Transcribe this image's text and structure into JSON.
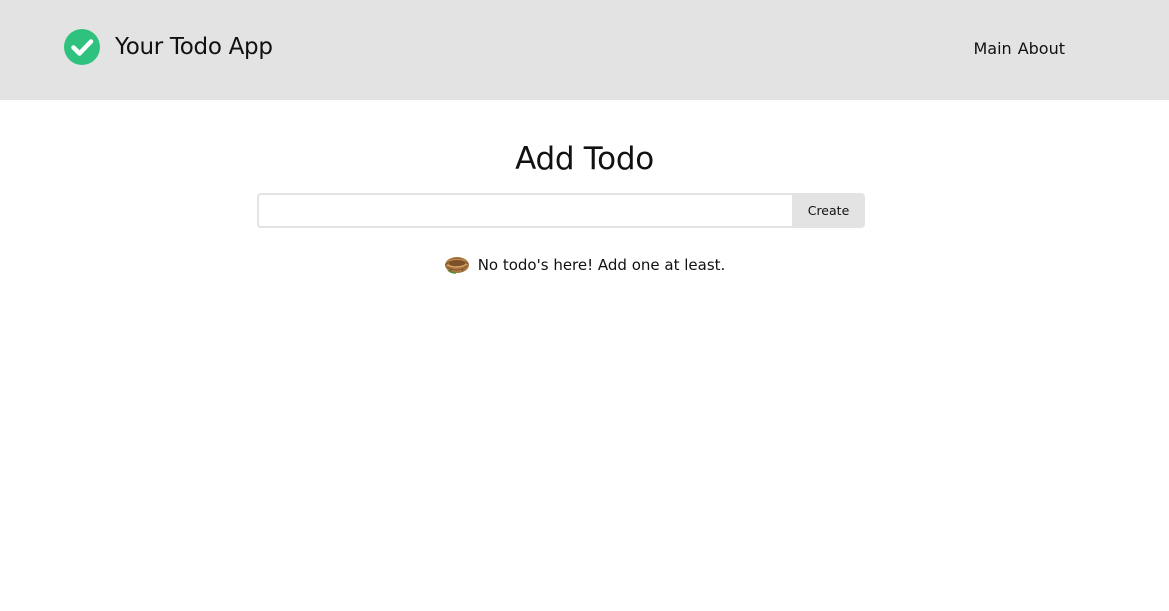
{
  "header": {
    "app_title": "Your Todo App",
    "logo_icon": "check-circle-icon",
    "logo_color": "#2ec27e",
    "background": "#e3e3e3",
    "nav": [
      {
        "label": "Main"
      },
      {
        "label": "About"
      }
    ]
  },
  "main": {
    "title": "Add Todo",
    "input": {
      "value": "",
      "placeholder": ""
    },
    "create_label": "Create",
    "empty_message": "No todo's here! Add one at least.",
    "empty_icon": "nest-icon"
  }
}
